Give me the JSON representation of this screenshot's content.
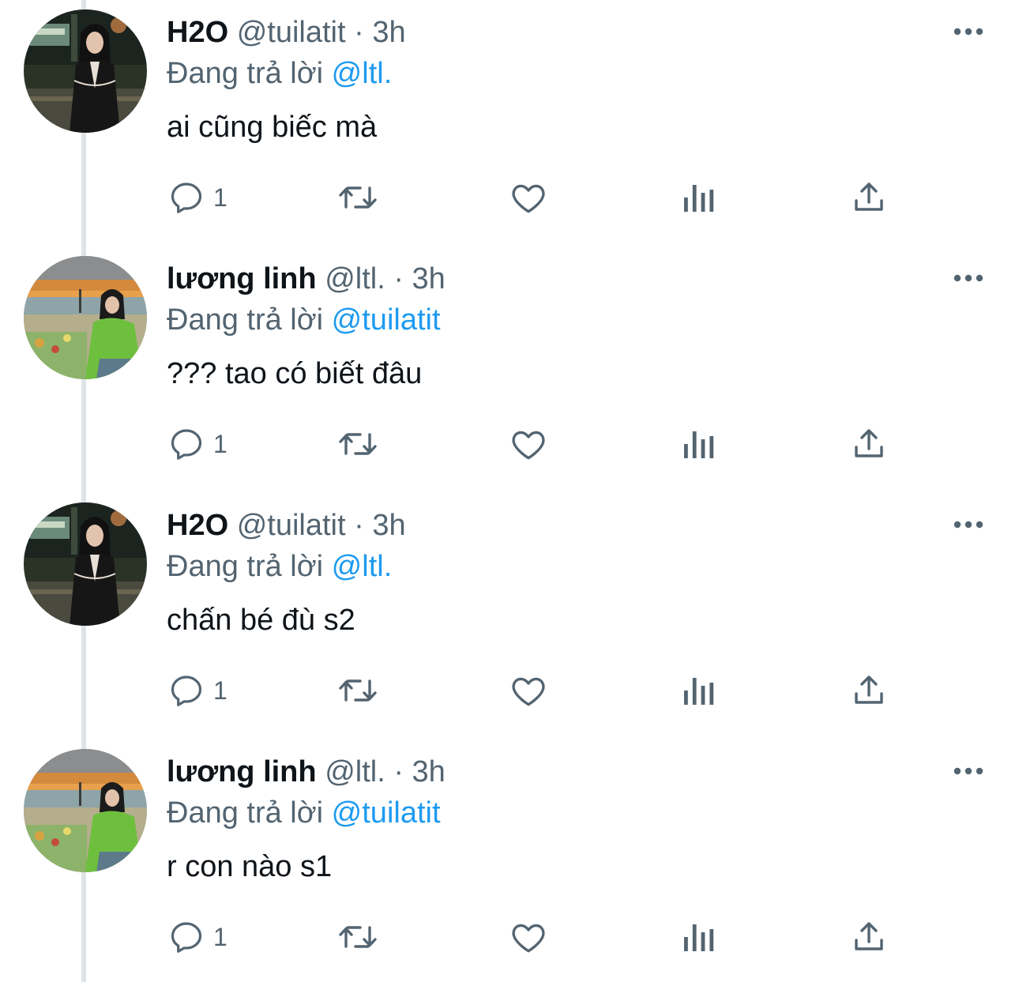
{
  "colors": {
    "text_primary": "#0f1419",
    "text_secondary": "#536471",
    "accent_blue": "#1d9bf0",
    "thread_line": "#dfe3e6",
    "icon_gray": "#536471"
  },
  "tweets": [
    {
      "display_name": "H2O",
      "handle": "@tuilatit",
      "separator": "·",
      "time": "3h",
      "reply_prefix": "Đang trả lời",
      "reply_to": "@ltl.",
      "text": "ai cũng biếc mà",
      "reply_count": "1",
      "avatar_scene": "night-street"
    },
    {
      "display_name": "lương linh",
      "handle": "@ltl.",
      "separator": "·",
      "time": "3h",
      "reply_prefix": "Đang trả lời",
      "reply_to": "@tuilatit",
      "text": "??? tao có biết đâu",
      "reply_count": "1",
      "avatar_scene": "sunset-beach"
    },
    {
      "display_name": "H2O",
      "handle": "@tuilatit",
      "separator": "·",
      "time": "3h",
      "reply_prefix": "Đang trả lời",
      "reply_to": "@ltl.",
      "text": "chấn bé đù s2",
      "reply_count": "1",
      "avatar_scene": "night-street"
    },
    {
      "display_name": "lương linh",
      "handle": "@ltl.",
      "separator": "·",
      "time": "3h",
      "reply_prefix": "Đang trả lời",
      "reply_to": "@tuilatit",
      "text": "r con nào s1",
      "reply_count": "1",
      "avatar_scene": "sunset-beach"
    }
  ],
  "icons": {
    "more": "more-dots-icon",
    "reply": "reply-bubble-icon",
    "retweet": "retweet-icon",
    "like": "heart-icon",
    "views": "views-bar-chart-icon",
    "share": "share-upload-icon"
  }
}
